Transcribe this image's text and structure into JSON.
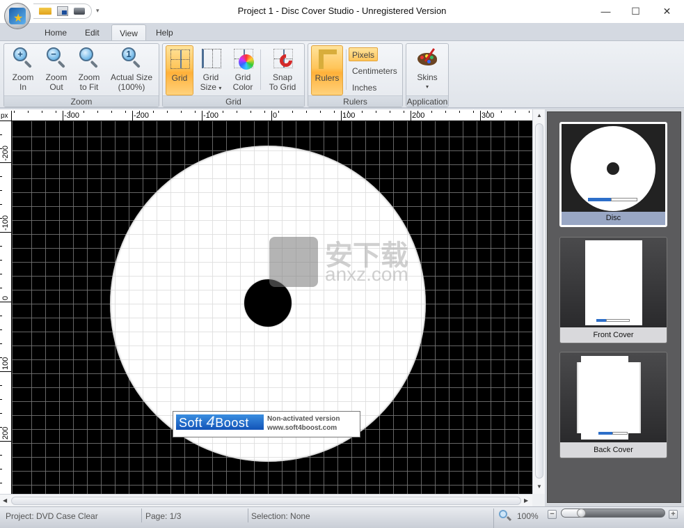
{
  "window": {
    "title": "Project 1 - Disc Cover Studio - Unregistered Version",
    "minimize_glyph": "—",
    "maximize_glyph": "☐",
    "close_glyph": "✕"
  },
  "quick_access": {
    "icons": [
      "open-icon",
      "save-icon",
      "print-icon"
    ],
    "more_glyph": "▾"
  },
  "tabs": [
    {
      "label": "Home",
      "active": false
    },
    {
      "label": "Edit",
      "active": false
    },
    {
      "label": "View",
      "active": true
    },
    {
      "label": "Help",
      "active": false
    }
  ],
  "ribbon": {
    "zoom_group": {
      "label": "Zoom",
      "buttons": [
        {
          "line1": "Zoom",
          "line2": "In",
          "icon": "zoom-in-icon",
          "glyph": "+"
        },
        {
          "line1": "Zoom",
          "line2": "Out",
          "icon": "zoom-out-icon",
          "glyph": "−"
        },
        {
          "line1": "Zoom",
          "line2": "to Fit",
          "icon": "zoom-fit-icon",
          "glyph": ""
        },
        {
          "line1": "Actual Size",
          "line2": "(100%)",
          "icon": "actual-size-icon",
          "glyph": "1"
        }
      ]
    },
    "grid_group": {
      "label": "Grid",
      "buttons": [
        {
          "line1": "Grid",
          "line2": "",
          "active": true
        },
        {
          "line1": "Grid",
          "line2": "Size",
          "dropdown": "▾"
        },
        {
          "line1": "Grid",
          "line2": "Color"
        },
        {
          "line1": "Snap",
          "line2": "To Grid"
        }
      ]
    },
    "rulers_group": {
      "label": "Rulers",
      "rulers_button": "Rulers",
      "units": [
        {
          "label": "Pixels",
          "active": true
        },
        {
          "label": "Centimeters",
          "active": false
        },
        {
          "label": "Inches",
          "active": false
        }
      ]
    },
    "application_group": {
      "label": "Application",
      "skins_button": "Skins",
      "dropdown": "▾"
    }
  },
  "rulers": {
    "unit_label": "px",
    "horizontal_labels": [
      "-300",
      "-200",
      "-100",
      "0",
      "100",
      "200",
      "300"
    ],
    "vertical_labels": [
      "-200",
      "-100",
      "0",
      "100",
      "200"
    ]
  },
  "canvas": {
    "background_color": "#000000",
    "disc_color": "#ffffff",
    "watermark": {
      "logo_soft": "Soft",
      "logo_four": "4",
      "logo_boost": "Boost",
      "line1": "Non-activated version",
      "line2": "www.soft4boost.com"
    },
    "overlay_watermark": {
      "chinese": "安下载",
      "site": "anxz.com"
    }
  },
  "scrollbars": {
    "up": "▲",
    "down": "▼",
    "left": "◀",
    "right": "▶"
  },
  "pages": [
    {
      "label": "Disc",
      "selected": true
    },
    {
      "label": "Front Cover",
      "selected": false
    },
    {
      "label": "Back Cover",
      "selected": false
    }
  ],
  "status": {
    "project": "Project: DVD Case Clear",
    "page": "Page: 1/3",
    "selection": "Selection: None",
    "zoom": "100%",
    "zoom_minus": "−",
    "zoom_plus": "+",
    "zoom_slider_fraction": 0.15
  },
  "colors": {
    "accent_active": "#ffc55a",
    "selected_page_label": "#99a7c4"
  }
}
